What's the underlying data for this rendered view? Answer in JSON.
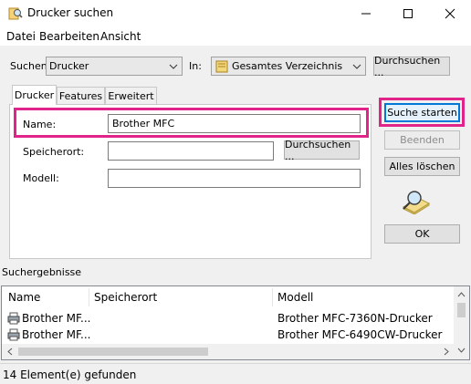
{
  "window": {
    "title": "Drucker suchen",
    "controls": [
      "minimize",
      "maximize",
      "close"
    ]
  },
  "menu": [
    "Datei",
    "Bearbeiten",
    "Ansicht"
  ],
  "search": {
    "search_label": "Suchen:",
    "search_value": "Drucker",
    "in_label": "In:",
    "in_value": "Gesamtes Verzeichnis",
    "browse_label": "Durchsuchen ..."
  },
  "tabs": [
    {
      "label": "Drucker",
      "active": true
    },
    {
      "label": "Features",
      "active": false
    },
    {
      "label": "Erweitert",
      "active": false
    }
  ],
  "form": {
    "name_label": "Name:",
    "name_value": "Brother MFC",
    "location_label": "Speicherort:",
    "location_value": "",
    "location_browse": "Durchsuchen ...",
    "model_label": "Modell:",
    "model_value": ""
  },
  "actions": {
    "start": "Suche starten",
    "stop": "Beenden",
    "clear": "Alles löschen",
    "ok": "OK"
  },
  "results": {
    "heading": "Suchergebnisse",
    "columns": [
      "Name",
      "Speicherort",
      "Modell"
    ],
    "rows": [
      {
        "name": "Brother MF...",
        "location": "",
        "model": "Brother MFC-7360N-Drucker"
      },
      {
        "name": "Brother MF...",
        "location": "",
        "model": "Brother MFC-6490CW-Drucker"
      }
    ]
  },
  "status": "14 Element(e) gefunden",
  "colors": {
    "highlight": "#e0248a",
    "focus": "#0078d7"
  }
}
